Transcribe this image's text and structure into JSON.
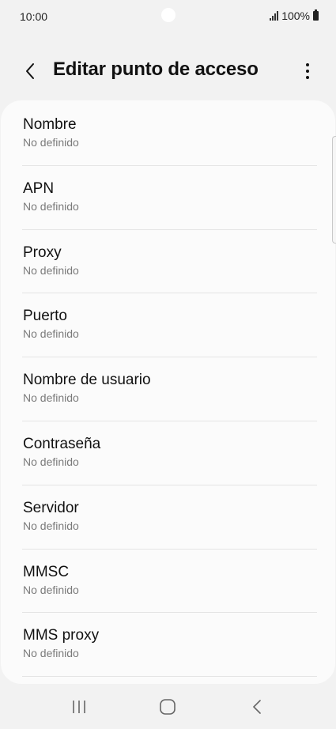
{
  "status_bar": {
    "time": "10:00",
    "battery_text": "100%",
    "icons": [
      "signal-icon",
      "battery-icon"
    ]
  },
  "header": {
    "title": "Editar punto de acceso",
    "back_icon": "chevron-left-icon",
    "more_icon": "more-vertical-icon"
  },
  "settings": {
    "items": [
      {
        "title": "Nombre",
        "value": "No definido"
      },
      {
        "title": "APN",
        "value": "No definido"
      },
      {
        "title": "Proxy",
        "value": "No definido"
      },
      {
        "title": "Puerto",
        "value": "No definido"
      },
      {
        "title": "Nombre de usuario",
        "value": "No definido"
      },
      {
        "title": "Contraseña",
        "value": "No definido"
      },
      {
        "title": "Servidor",
        "value": "No definido"
      },
      {
        "title": "MMSC",
        "value": "No definido"
      },
      {
        "title": "MMS proxy",
        "value": "No definido"
      }
    ]
  },
  "nav_bar": {
    "icons": [
      "recents-icon",
      "home-icon",
      "back-icon"
    ]
  },
  "colors": {
    "background": "#f2f2f2",
    "card": "#fbfbfb",
    "text_primary": "#111111",
    "text_secondary": "#7a7a7a",
    "divider": "#e4e4e4"
  }
}
